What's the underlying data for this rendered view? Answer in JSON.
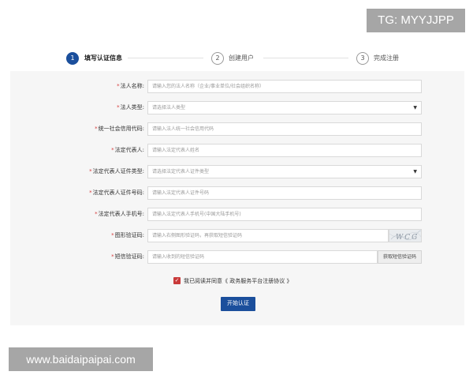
{
  "watermarks": {
    "top_right": "TG: MYYJJPP",
    "bottom_left": "www.baidaipaipai.com"
  },
  "steps": [
    {
      "num": "1",
      "label": "填写认证信息",
      "active": true
    },
    {
      "num": "2",
      "label": "创建用户",
      "active": false
    },
    {
      "num": "3",
      "label": "完成注册",
      "active": false
    }
  ],
  "form": {
    "fields": [
      {
        "label": "法人名称:",
        "placeholder": "请输入您的法人名称（企业/事业单位/社会组织名称）",
        "kind": "text"
      },
      {
        "label": "法人类型:",
        "placeholder": "请选择法人类型",
        "kind": "select"
      },
      {
        "label": "统一社会信用代码:",
        "placeholder": "请输入法人统一社会信用代码",
        "kind": "text"
      },
      {
        "label": "法定代表人:",
        "placeholder": "请输入法定代表人姓名",
        "kind": "text"
      },
      {
        "label": "法定代表人证件类型:",
        "placeholder": "请选择法定代表人证件类型",
        "kind": "select"
      },
      {
        "label": "法定代表人证件号码:",
        "placeholder": "请输入法定代表人证件号码",
        "kind": "text"
      },
      {
        "label": "法定代表人手机号:",
        "placeholder": "请输入法定代表人手机号(中国大陆手机号)",
        "kind": "text"
      },
      {
        "label": "图形验证码:",
        "placeholder": "请输入右侧图形验证码，再获取短信验证码",
        "kind": "captcha",
        "captcha_text": "WCG"
      },
      {
        "label": "短信验证码:",
        "placeholder": "请输入收到的短信验证码",
        "kind": "sms",
        "button_label": "获取短信验证码"
      }
    ],
    "agreement": "我已阅读并同意《 政务服务平台注册协议 》",
    "agreement_checked": true,
    "submit_label": "开始认证"
  },
  "colors": {
    "primary": "#1b4f9c",
    "required": "#d53c3c",
    "checkbox": "#c93a3a"
  }
}
